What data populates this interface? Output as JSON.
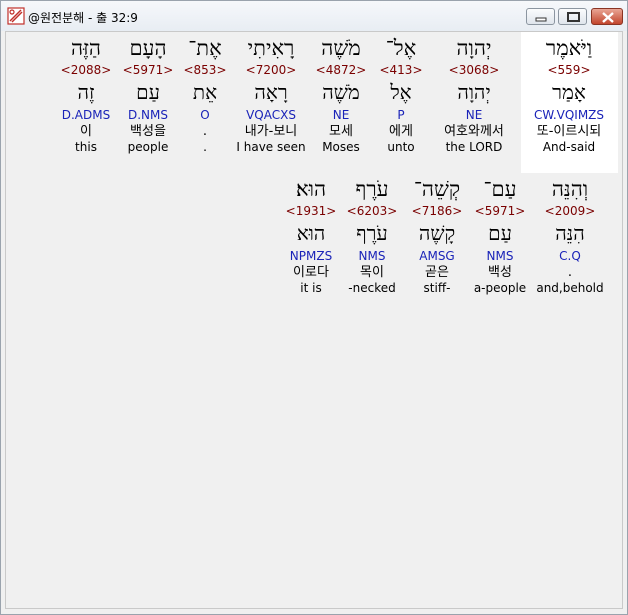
{
  "window": {
    "title": "@원전분해 - 출 32:9"
  },
  "rows": [
    [
      {
        "heb": "וַיֹּאמֶר",
        "strong": "<559>",
        "lemma": "אָמַר",
        "morph": "CW.VQIMZS",
        "kor": "또-이르시되",
        "eng": "And-said"
      },
      {
        "heb": "יְהוָה",
        "strong": "<3068>",
        "lemma": "יְהוָה",
        "morph": "NE",
        "kor": "여호와께서",
        "eng": "the LORD"
      },
      {
        "heb": "אֶל־",
        "strong": "<413>",
        "lemma": "אֶל",
        "morph": "P",
        "kor": "에게",
        "eng": "unto"
      },
      {
        "heb": "מֹשֶׁה",
        "strong": "<4872>",
        "lemma": "מֹשֶׁה",
        "morph": "NE",
        "kor": "모세",
        "eng": "Moses"
      },
      {
        "heb": "רָאִיתִי",
        "strong": "<7200>",
        "lemma": "רָאָה",
        "morph": "VQACXS",
        "kor": "내가-보니",
        "eng": "I have seen"
      },
      {
        "heb": "אֶת־",
        "strong": "<853>",
        "lemma": "אֵת",
        "morph": "O",
        "kor": ".",
        "eng": "."
      },
      {
        "heb": "הָעָם",
        "strong": "<5971>",
        "lemma": "עַם",
        "morph": "D.NMS",
        "kor": "백성을",
        "eng": "people"
      },
      {
        "heb": "הַזֶּה",
        "strong": "<2088>",
        "lemma": "זֶה",
        "morph": "D.ADMS",
        "kor": "이",
        "eng": "this"
      }
    ],
    [
      {
        "heb": "וְהִנֵּה",
        "strong": "<2009>",
        "lemma": "הִנֵּה",
        "morph": "C.Q",
        "kor": ".",
        "eng": "and,behold"
      },
      {
        "heb": "עַם־",
        "strong": "<5971>",
        "lemma": "עַם",
        "morph": "NMS",
        "kor": "백성",
        "eng": "a-people"
      },
      {
        "heb": "קְשֵׁה־",
        "strong": "<7186>",
        "lemma": "קָשֶׁה",
        "morph": "AMSG",
        "kor": "곧은",
        "eng": "stiff-"
      },
      {
        "heb": "עֹרֶף",
        "strong": "<6203>",
        "lemma": "עֹרֶף",
        "morph": "NMS",
        "kor": "목이",
        "eng": "-necked"
      },
      {
        "heb": "הוּא׃",
        "strong": "<1931>",
        "lemma": "הוּא",
        "morph": "NPMZS",
        "kor": "이로다",
        "eng": "it is"
      }
    ]
  ]
}
